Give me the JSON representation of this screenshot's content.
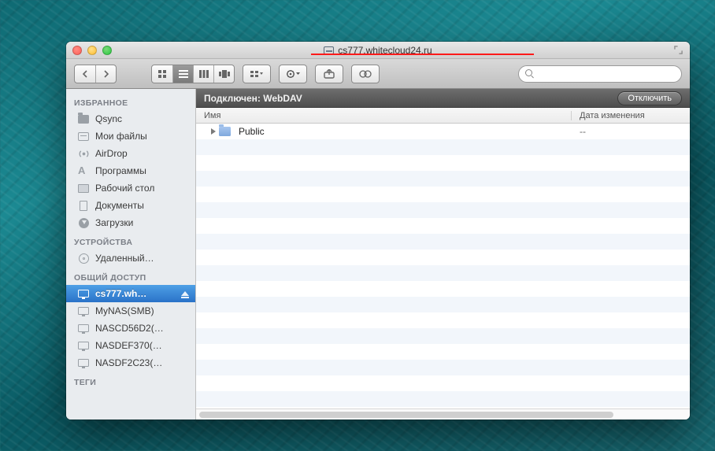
{
  "window": {
    "title": "cs777.whitecloud24.ru"
  },
  "toolbar": {
    "search_placeholder": ""
  },
  "status": {
    "label": "Подключен:",
    "value": "WebDAV",
    "disconnect": "Отключить"
  },
  "columns": {
    "name": "Имя",
    "date": "Дата изменения"
  },
  "sidebar": {
    "groups": [
      {
        "title": "ИЗБРАННОЕ",
        "items": [
          {
            "icon": "folder",
            "label": "Qsync"
          },
          {
            "icon": "drive",
            "label": "Мои файлы"
          },
          {
            "icon": "airdrop",
            "label": "AirDrop"
          },
          {
            "icon": "app",
            "label": "Программы"
          },
          {
            "icon": "desk",
            "label": "Рабочий стол"
          },
          {
            "icon": "doc",
            "label": "Документы"
          },
          {
            "icon": "dl",
            "label": "Загрузки"
          }
        ]
      },
      {
        "title": "УСТРОЙСТВА",
        "items": [
          {
            "icon": "cd",
            "label": "Удаленный…"
          }
        ]
      },
      {
        "title": "ОБЩИЙ ДОСТУП",
        "items": [
          {
            "icon": "mon",
            "label": "cs777.wh…",
            "selected": true,
            "eject": true
          },
          {
            "icon": "mon",
            "label": "MyNAS(SMB)"
          },
          {
            "icon": "mon",
            "label": "NASCD56D2(…"
          },
          {
            "icon": "mon",
            "label": "NASDEF370(…"
          },
          {
            "icon": "mon",
            "label": "NASDF2C23(…"
          }
        ]
      },
      {
        "title": "ТЕГИ",
        "items": []
      }
    ]
  },
  "files": [
    {
      "name": "Public",
      "date": "--"
    }
  ]
}
